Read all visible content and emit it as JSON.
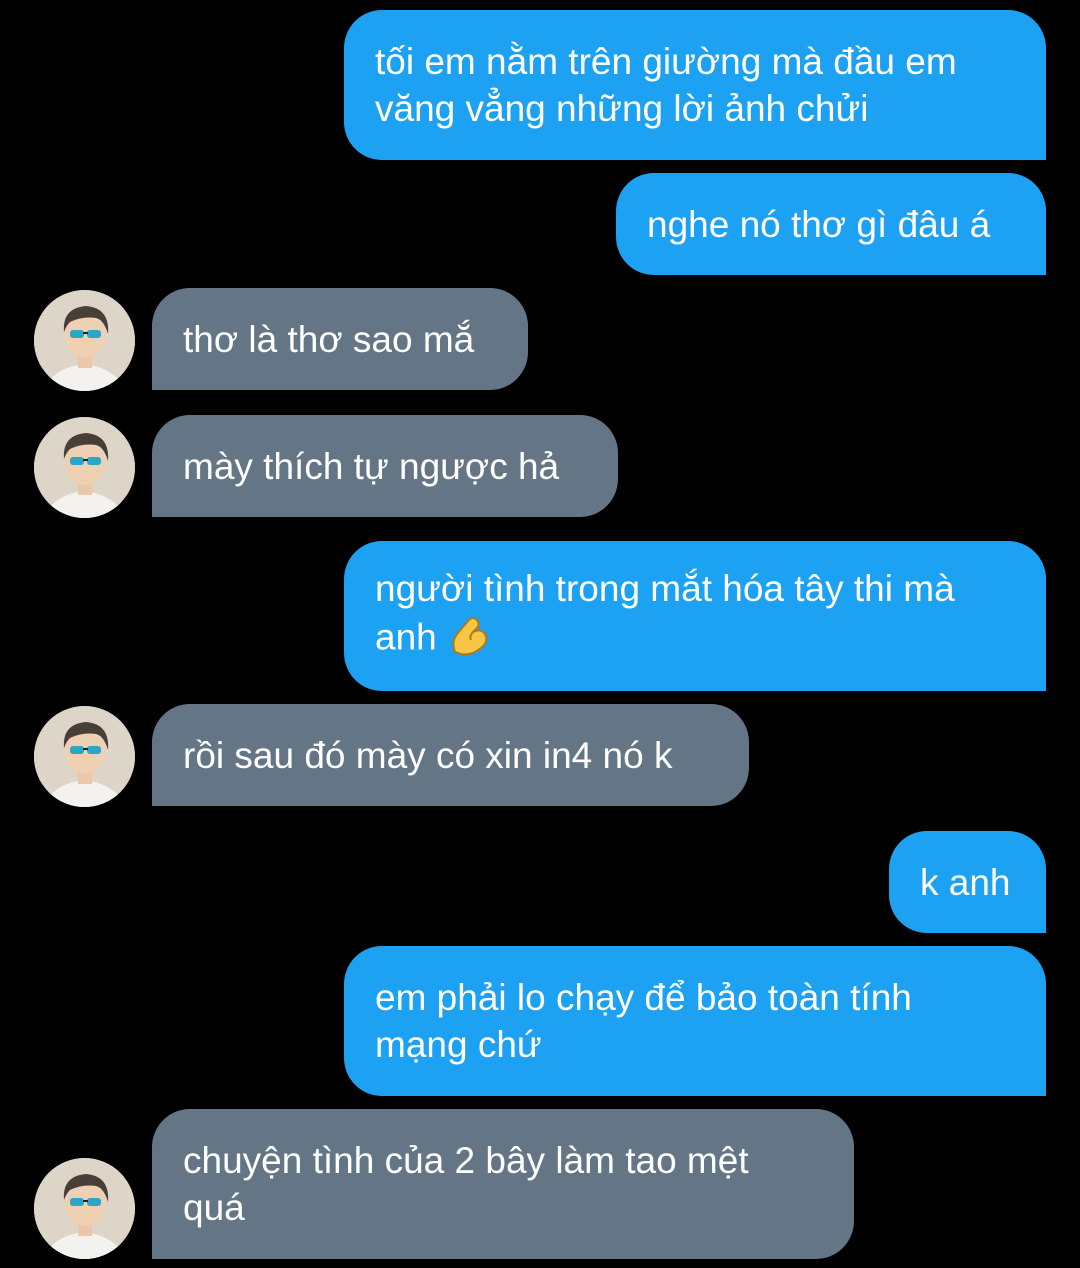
{
  "conversation": {
    "messages": [
      {
        "side": "sent",
        "lines": [
          "tối em nằm trên giường mà đầu em",
          "văng vẳng những lời ảnh chửi"
        ]
      },
      {
        "side": "sent",
        "lines": [
          "nghe nó thơ gì đâu á"
        ]
      },
      {
        "side": "received",
        "lines": [
          "thơ là thơ sao mắ"
        ]
      },
      {
        "side": "received",
        "lines": [
          "mày thích tự ngược hả"
        ]
      },
      {
        "side": "sent",
        "lines": [
          "người tình trong mắt hóa tây thi mà",
          "anh"
        ],
        "emoji": "pinching-hand-emoji"
      },
      {
        "side": "received",
        "lines": [
          "rồi sau đó mày có xin in4 nó k"
        ]
      },
      {
        "side": "sent",
        "lines": [
          "k anh"
        ]
      },
      {
        "side": "sent",
        "lines": [
          "em phải lo chạy để bảo toàn tính",
          "mạng chứ"
        ]
      },
      {
        "side": "received",
        "lines": [
          "chuyện tình của 2 bây làm tao mệt",
          "quá"
        ]
      }
    ]
  },
  "colors": {
    "background": "#000000",
    "sent_bubble": "#1da1f2",
    "received_bubble": "#647585",
    "text": "#ffffff"
  },
  "icons": {
    "avatar": "contact-avatar-photo",
    "emoji": "pinching-hand-emoji"
  }
}
